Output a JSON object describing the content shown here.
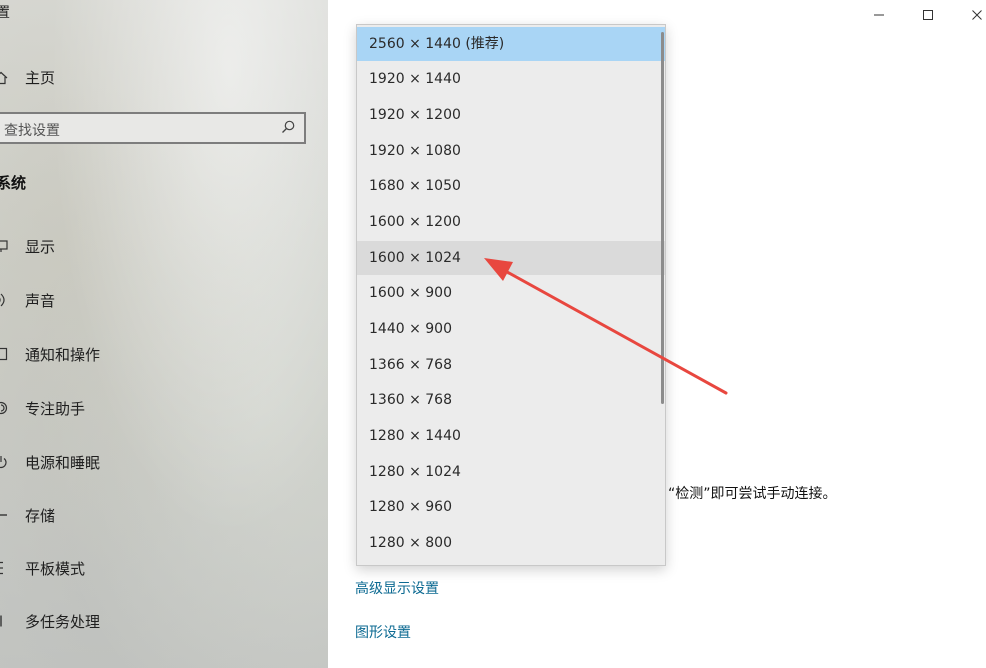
{
  "window": {
    "title": "置",
    "minimize_icon": "minimize-icon",
    "maximize_icon": "maximize-icon",
    "close_icon": "close-icon"
  },
  "sidebar": {
    "home_label": "主页",
    "search_placeholder": "查找设置",
    "section_title": "系统",
    "items": [
      {
        "label": "显示",
        "icon": "monitor-icon"
      },
      {
        "label": "声音",
        "icon": "speaker-icon"
      },
      {
        "label": "通知和操作",
        "icon": "notification-icon"
      },
      {
        "label": "专注助手",
        "icon": "moon-icon"
      },
      {
        "label": "电源和睡眠",
        "icon": "power-icon"
      },
      {
        "label": "存储",
        "icon": "storage-icon"
      },
      {
        "label": "平板模式",
        "icon": "tablet-icon"
      },
      {
        "label": "多任务处理",
        "icon": "multitask-icon"
      }
    ]
  },
  "main": {
    "detect_hint": "“检测”即可尝试手动连接。",
    "advanced_display_link": "高级显示设置",
    "graphics_link": "图形设置"
  },
  "resolution_dropdown": {
    "selected": "2560 × 1440 (推荐)",
    "highlighted": "1600 × 1024",
    "options": [
      "2560 × 1440 (推荐)",
      "1920 × 1440",
      "1920 × 1200",
      "1920 × 1080",
      "1680 × 1050",
      "1600 × 1200",
      "1600 × 1024",
      "1600 × 900",
      "1440 × 900",
      "1366 × 768",
      "1360 × 768",
      "1280 × 1440",
      "1280 × 1024",
      "1280 × 960",
      "1280 × 800"
    ]
  },
  "colors": {
    "selected_option": "#a9d5f5",
    "hover_option": "#dadada",
    "link": "#0c6a92",
    "annotation_arrow": "#e8473f"
  }
}
